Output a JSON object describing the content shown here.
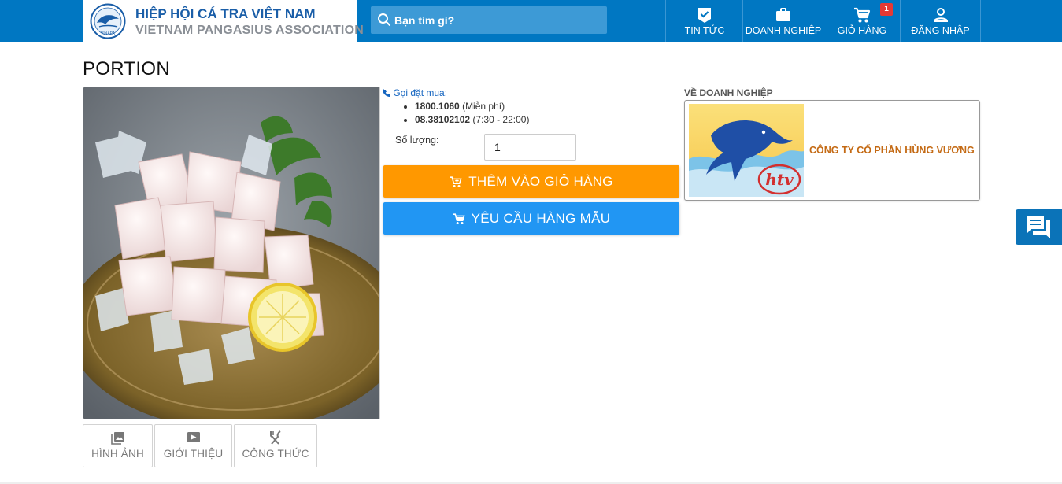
{
  "header": {
    "logo_emblem_text": "VINAPA",
    "logo_title": "HIỆP HỘI CÁ TRA VIỆT NAM",
    "logo_subtitle": "VIETNAM PANGASIUS ASSOCIATION",
    "search_placeholder": "Bạn tìm gì?",
    "nav": [
      {
        "label": "TIN TỨC",
        "icon": "news-check-icon"
      },
      {
        "label": "DOANH NGHIỆP",
        "icon": "briefcase-icon"
      },
      {
        "label": "GIỎ HÀNG",
        "icon": "cart-icon",
        "badge": "1"
      },
      {
        "label": "ĐĂNG NHẬP",
        "icon": "user-icon"
      }
    ]
  },
  "product": {
    "title": "PORTION",
    "call_label": "Gọi đặt mua:",
    "phones": [
      {
        "number": "1800.1060",
        "note": " (Miễn phí)"
      },
      {
        "number": "08.38102102",
        "note": " (7:30 - 22:00)"
      }
    ],
    "quantity_label": "Số lượng:",
    "quantity_value": "1",
    "add_to_cart_label": "THÊM VÀO GIỎ HÀNG",
    "request_sample_label": "YÊU CẦU HÀNG MẪU",
    "tabs": [
      {
        "label": "HÌNH ẢNH",
        "icon": "image-icon"
      },
      {
        "label": "GIỚI THIỆU",
        "icon": "video-icon"
      },
      {
        "label": "CÔNG THỨC",
        "icon": "utensils-icon"
      }
    ]
  },
  "company": {
    "heading": "VỀ DOANH NGHIỆP",
    "name": "CÔNG TY CỔ PHẦN HÙNG VƯƠNG",
    "logo_text": "htv"
  },
  "colors": {
    "header_blue": "#0077c2",
    "orange_button": "#ff9800",
    "blue_button": "#2196f3",
    "company_name": "#c46a14",
    "badge_red": "#e53935"
  }
}
